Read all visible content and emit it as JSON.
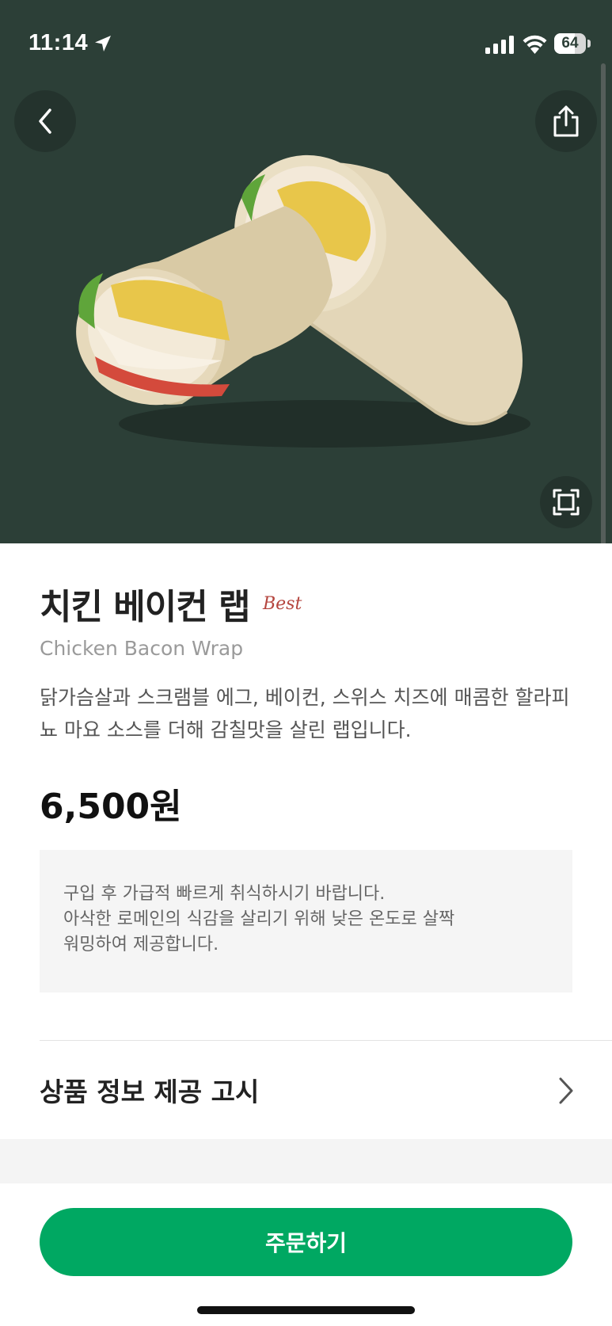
{
  "status_bar": {
    "time": "11:14",
    "battery_level": "64",
    "battery_fraction": 0.64
  },
  "hero": {
    "background_color": "#2c3f37",
    "image": "chicken-bacon-wrap-photo",
    "buttons": [
      "back-icon",
      "share-icon",
      "expand-icon"
    ]
  },
  "product": {
    "name_ko": "치킨 베이컨 랩",
    "badge": "Best",
    "name_en": "Chicken Bacon Wrap",
    "description": "닭가슴살과 스크램블 에그, 베이컨, 스위스 치즈에 매콤한 할라피뇨 마요 소스를 더해 감칠맛을 살린 랩입니다.",
    "price": "6,500원"
  },
  "notice": {
    "lines": [
      "구입 후 가급적 빠르게 취식하시기 바랍니다.",
      "아삭한 로메인의 식감을 살리기 위해 낮은 온도로 살짝",
      "워밍하여 제공합니다."
    ]
  },
  "info": {
    "label": "상품 정보 제공 고시"
  },
  "actions": {
    "order_label": "주문하기"
  },
  "colors": {
    "accent": "#00a862",
    "badge": "#b5463f"
  }
}
